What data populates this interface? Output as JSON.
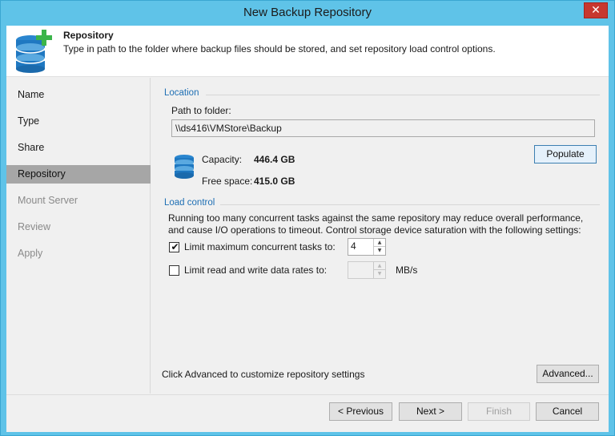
{
  "window": {
    "title": "New Backup Repository",
    "close_glyph": "✕"
  },
  "header": {
    "title": "Repository",
    "description": "Type in path to the folder where backup files should be stored, and set repository load control options.",
    "icon": "database-add-icon"
  },
  "sidebar": {
    "steps": [
      {
        "label": "Name",
        "state": "completed"
      },
      {
        "label": "Type",
        "state": "completed"
      },
      {
        "label": "Share",
        "state": "completed"
      },
      {
        "label": "Repository",
        "state": "active"
      },
      {
        "label": "Mount Server",
        "state": "disabled"
      },
      {
        "label": "Review",
        "state": "disabled"
      },
      {
        "label": "Apply",
        "state": "disabled"
      }
    ]
  },
  "location": {
    "group_label": "Location",
    "path_label": "Path to folder:",
    "path_value": "\\\\ds416\\VMStore\\Backup",
    "capacity_label": "Capacity:",
    "capacity_value": "446.4 GB",
    "free_label": "Free space:",
    "free_value": "415.0 GB",
    "populate_label": "Populate"
  },
  "load_control": {
    "group_label": "Load control",
    "description_line1": "Running too many concurrent tasks against the same repository may reduce overall performance,",
    "description_line2": "and cause I/O operations to timeout. Control storage device saturation with the following settings:",
    "limit_tasks_label": "Limit maximum concurrent tasks to:",
    "limit_tasks_checked": true,
    "limit_tasks_value": "4",
    "limit_rate_label": "Limit read and write data rates to:",
    "limit_rate_checked": false,
    "limit_rate_value": "",
    "rate_unit": "MB/s",
    "check_glyph": "✔"
  },
  "advanced": {
    "hint": "Click Advanced to customize repository settings",
    "button_label": "Advanced..."
  },
  "footer": {
    "previous_label": "< Previous",
    "next_label": "Next >",
    "finish_label": "Finish",
    "cancel_label": "Cancel"
  },
  "colors": {
    "title_bar": "#5fc3e8",
    "accent_group_label": "#1e6fb4",
    "close_button": "#c7372f",
    "active_step": "#a6a6a6",
    "add_plus": "#3bb54a",
    "database": "#1f78c1"
  }
}
